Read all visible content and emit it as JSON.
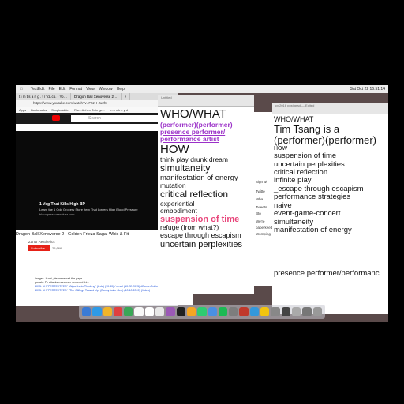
{
  "menubar": {
    "items": [
      "TextEdit",
      "File",
      "Edit",
      "Format",
      "View",
      "Window",
      "Help"
    ],
    "clock": "Sat Oct 22  16:51:14"
  },
  "chrome": {
    "tabs": [
      "t i m t s a n g . t / VΔ co. - Yo…",
      "Dragon Ball Xenoverse 2…",
      "×"
    ],
    "url": "https://www.youtube.com/watch?v=F5zH-Ju2hI",
    "bookmarks": [
      "Apps",
      "Bookmarks",
      "SimpleAdder",
      "Rare Aphex Twin ge...",
      "m o n k e y d"
    ],
    "search_placeholder": "Search",
    "ad_title": "1 Veg That Kills High BP",
    "ad_line": "Learn the 1 Odd Grocery Store Item That Lowers High Blood Pressure",
    "ad_site": "bloodpressuresolver.com",
    "video_title": "Dragon Ball Xenoverse 2 - Golden Frieza Saga, Whis & Fit",
    "channel": "Zanar Aesthetics",
    "subscribe": "Subscribe",
    "sub_count": "25,666"
  },
  "bg_window": {
    "lines": [
      "images. If not, please reload the page.",
      "portals. Pc attacks maneuver centered thi...",
      "2015: #HYPERTEXTFED\" \"Algorithmic Thinking\" (k.de) (10.30) / email (10.22.2015) #BumerCollisier Remixpire (video)",
      "2015: #HYPERTEXTFED* \"Tim Clifings Tessed Up\" (Bunny Lake Gen) (10.10.2015) (Video)"
    ]
  },
  "note1": {
    "title": "Untitled",
    "lines": [
      {
        "text": "WHO/WHAT",
        "size": 15,
        "color": "#111",
        "bold": false,
        "u": false
      },
      {
        "text": "(performer)(performer)",
        "size": 8.5,
        "color": "#9b30c8",
        "bold": true,
        "u": false
      },
      {
        "text": "presence performer/",
        "size": 8.5,
        "color": "#9b30c8",
        "bold": true,
        "u": true
      },
      {
        "text": "performance artist",
        "size": 8.5,
        "color": "#9b30c8",
        "bold": true,
        "u": true
      },
      {
        "text": "HOW",
        "size": 15,
        "color": "#111",
        "bold": false,
        "u": false
      },
      {
        "text": "think play drunk dream",
        "size": 8.5,
        "color": "#111",
        "bold": false,
        "u": false
      },
      {
        "text": "simultaneity",
        "size": 12,
        "color": "#111",
        "bold": false,
        "u": false
      },
      {
        "text": "manifestation of energy",
        "size": 9.5,
        "color": "#111",
        "bold": false,
        "u": false
      },
      {
        "text": "mutation",
        "size": 8.5,
        "color": "#111",
        "bold": false,
        "u": false
      },
      {
        "text": "critical reflection",
        "size": 12,
        "color": "#111",
        "bold": false,
        "u": false
      },
      {
        "text": "experiential",
        "size": 8.5,
        "color": "#111",
        "bold": false,
        "u": false
      },
      {
        "text": "embodiment",
        "size": 8.5,
        "color": "#111",
        "bold": false,
        "u": false
      },
      {
        "text": "suspension of time",
        "size": 11,
        "color": "#e8457a",
        "bold": true,
        "u": false
      },
      {
        "text": "refuge (from what?)",
        "size": 8.5,
        "color": "#111",
        "bold": false,
        "u": false
      },
      {
        "text": "escape through escapism",
        "size": 9,
        "color": "#111",
        "bold": false,
        "u": false
      },
      {
        "text": "uncertain perplexities",
        "size": 11,
        "color": "#111",
        "bold": false,
        "u": false
      }
    ]
  },
  "note2": {
    "title": "cv 2016 post grad — Edited",
    "lines": [
      {
        "text": "WHO/WHAT",
        "size": 9,
        "color": "#111"
      },
      {
        "text": "Tim Tsang is a",
        "size": 13,
        "color": "#111"
      },
      {
        "text": "(performer)(performer)",
        "size": 13,
        "color": "#111"
      },
      {
        "text": "HOW",
        "size": 7,
        "color": "#111"
      },
      {
        "text": "suspension of time",
        "size": 9.5,
        "color": "#111"
      },
      {
        "text": "uncertain perplexities",
        "size": 9.5,
        "color": "#111"
      },
      {
        "text": "critical reflection",
        "size": 9.5,
        "color": "#111"
      },
      {
        "text": "infinite play",
        "size": 9.5,
        "color": "#111"
      },
      {
        "text": "_escape through escapism",
        "size": 9.5,
        "color": "#111"
      },
      {
        "text": "performance strategies",
        "size": 9.5,
        "color": "#111"
      },
      {
        "text": "naive",
        "size": 9.5,
        "color": "#111"
      },
      {
        "text": "event-game-concert",
        "size": 9.5,
        "color": "#111"
      },
      {
        "text": "simultaneity",
        "size": 9.5,
        "color": "#111"
      },
      {
        "text": "manifestation of energy",
        "size": 9.5,
        "color": "#111"
      }
    ],
    "footer": "presence performer/performanc"
  },
  "twitter": {
    "items": [
      "Sign wi",
      "Twitte",
      "Wha",
      "Tweets",
      "Bto",
      "We're",
      "paperkeed",
      "Womping"
    ]
  },
  "dock": {
    "colors": [
      "#3a7bd5",
      "#2e9ae6",
      "#f0b429",
      "#e04040",
      "#3aa757",
      "#f8f8f8",
      "#ffffff",
      "#e8e8e8",
      "#9b59b6",
      "#202020",
      "#f5a623",
      "#2ecc71",
      "#4a90e2",
      "#1db954",
      "#7d7d7d",
      "#c0392b",
      "#3498db",
      "#f1c40f",
      "#888",
      "#444",
      "#aaa",
      "#777",
      "#999"
    ]
  }
}
